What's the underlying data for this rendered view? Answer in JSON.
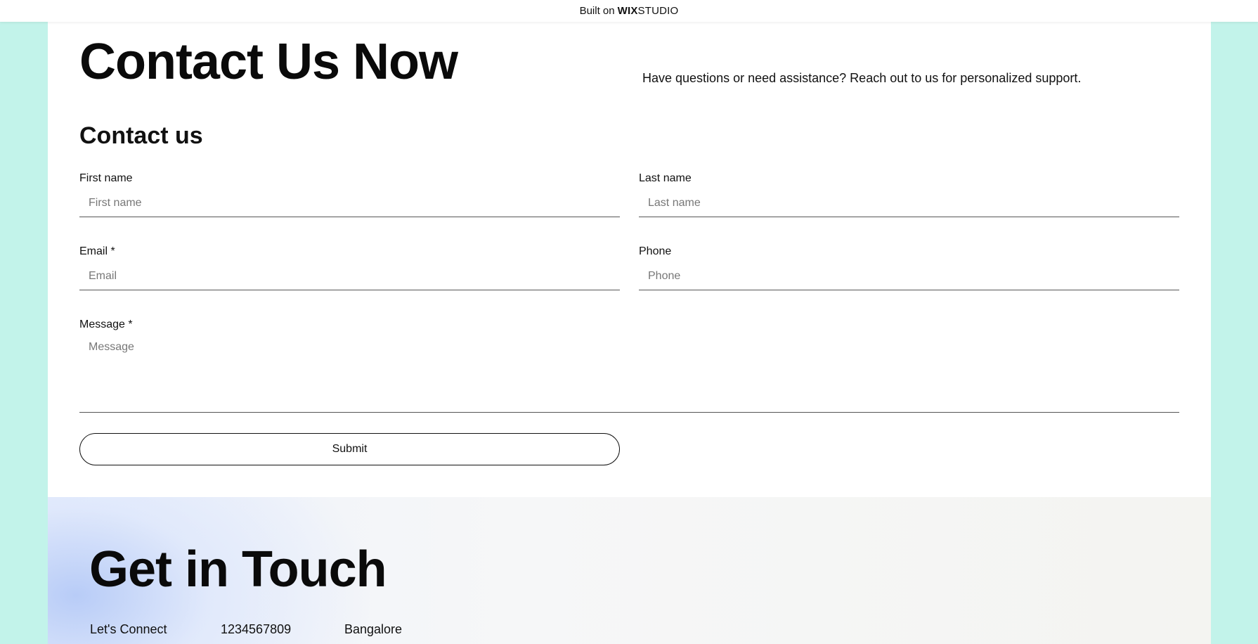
{
  "topbar": {
    "prefix": "Built on",
    "brand": "WIX",
    "brand_suffix": "STUDIO"
  },
  "hero": {
    "title": "Contact Us Now",
    "subtitle": "Have questions or need assistance? Reach out to us for personalized support."
  },
  "form": {
    "title": "Contact us",
    "first_name": {
      "label": "First name",
      "placeholder": "First name",
      "value": ""
    },
    "last_name": {
      "label": "Last name",
      "placeholder": "Last name",
      "value": ""
    },
    "email": {
      "label": "Email *",
      "placeholder": "Email",
      "value": ""
    },
    "phone": {
      "label": "Phone",
      "placeholder": "Phone",
      "value": ""
    },
    "message": {
      "label": "Message *",
      "placeholder": "Message",
      "value": ""
    },
    "submit_label": "Submit"
  },
  "footer": {
    "title": "Get in Touch",
    "items": [
      "Let's Connect",
      "1234567809",
      "Bangalore"
    ]
  },
  "colors": {
    "background": "#c2f3ea",
    "page": "#ffffff",
    "text": "#111111",
    "footer_accent": "#b8ccf7"
  }
}
